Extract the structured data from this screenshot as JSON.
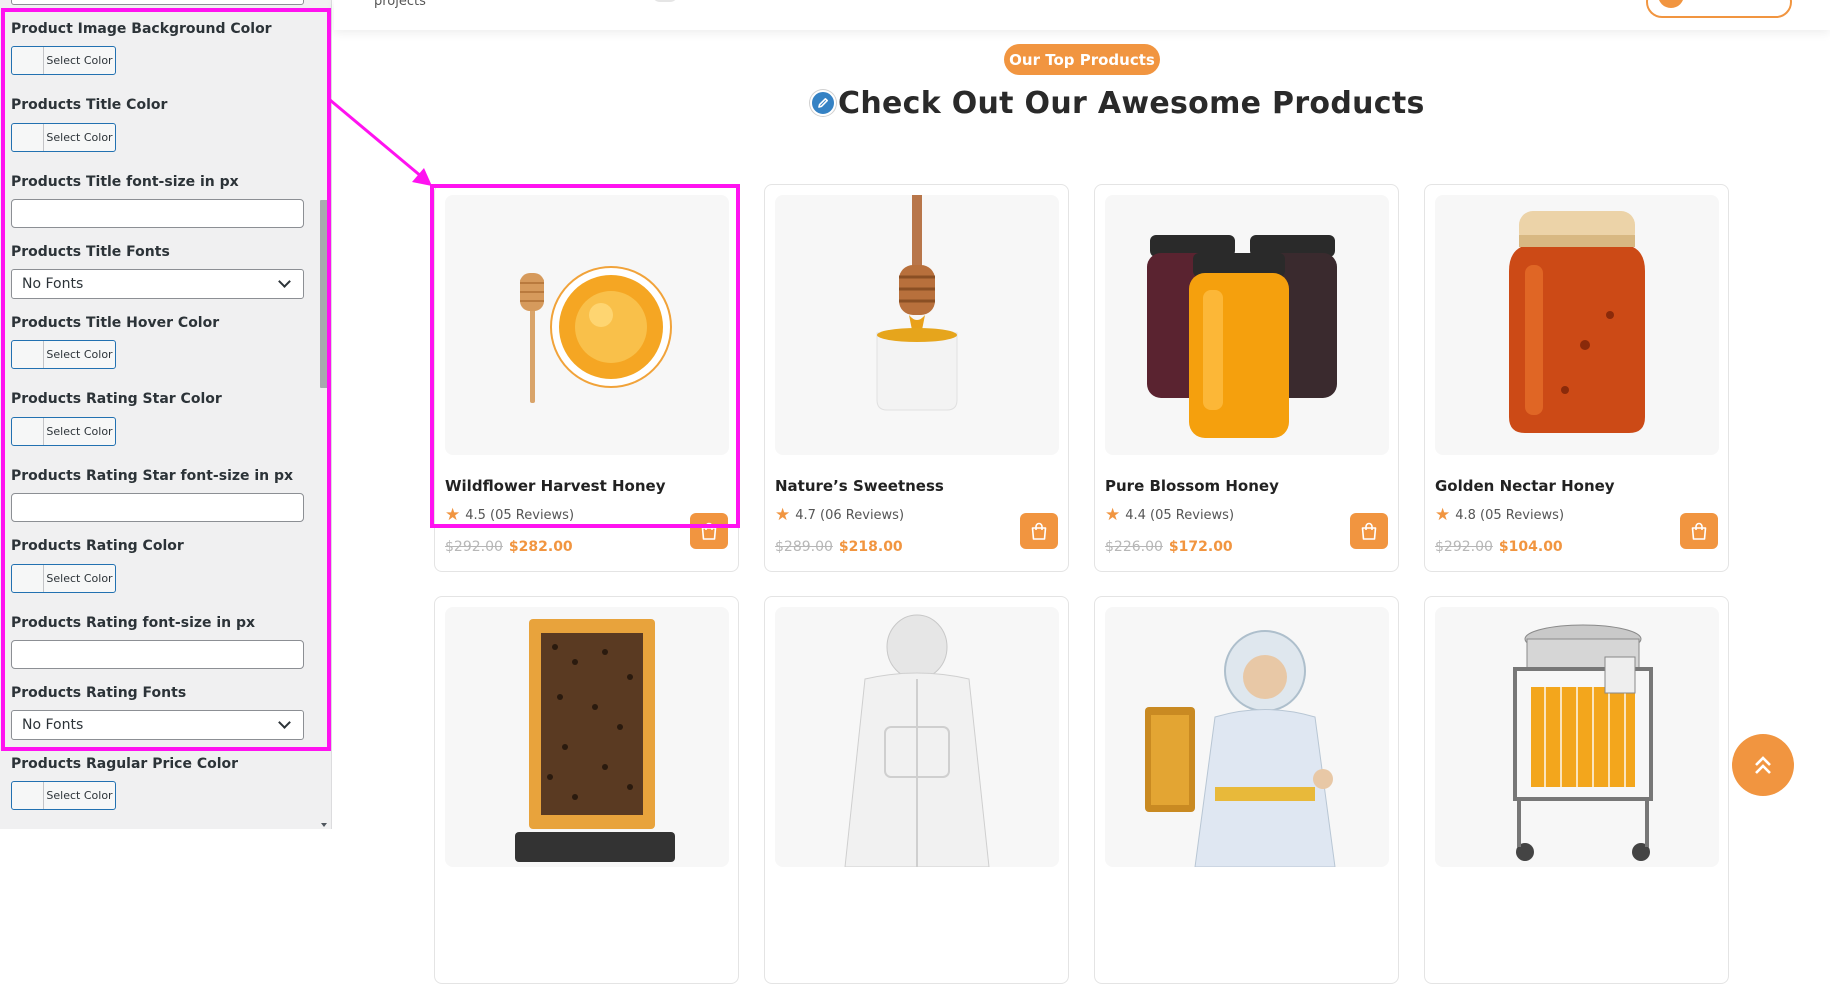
{
  "customizer": {
    "fields": [
      {
        "label": "Product Image Background Color",
        "type": "color",
        "button": "Select Color"
      },
      {
        "label": "Products Title Color",
        "type": "color",
        "button": "Select Color"
      },
      {
        "label": "Products Title font-size in px",
        "type": "text",
        "value": ""
      },
      {
        "label": "Products Title Fonts",
        "type": "select",
        "value": "No Fonts"
      },
      {
        "label": "Products Title Hover Color",
        "type": "color",
        "button": "Select Color"
      },
      {
        "label": "Products Rating Star Color",
        "type": "color",
        "button": "Select Color"
      },
      {
        "label": "Products Rating Star font-size in px",
        "type": "text",
        "value": ""
      },
      {
        "label": "Products Rating Color",
        "type": "color",
        "button": "Select Color"
      },
      {
        "label": "Products Rating font-size in px",
        "type": "text",
        "value": ""
      },
      {
        "label": "Products Rating Fonts",
        "type": "select",
        "value": "No Fonts"
      },
      {
        "label": "Products Ragular Price Color",
        "type": "color",
        "button": "Select Color"
      }
    ]
  },
  "header": {
    "projects_text": "projects"
  },
  "section": {
    "badge": "Our Top Products",
    "title": "Check Out Our Awesome Products"
  },
  "products": [
    {
      "title": "Wildflower Harvest Honey",
      "rating": "4.5 (05 Reviews)",
      "old_price": "$292.00",
      "price": "$282.00",
      "image": "honey-dipper-bowl"
    },
    {
      "title": "Nature’s Sweetness",
      "rating": "4.7 (06 Reviews)",
      "old_price": "$289.00",
      "price": "$218.00",
      "image": "honey-dipper-cup"
    },
    {
      "title": "Pure Blossom Honey",
      "rating": "4.4 (05 Reviews)",
      "old_price": "$226.00",
      "price": "$172.00",
      "image": "three-jars"
    },
    {
      "title": "Golden Nectar Honey",
      "rating": "4.8 (05 Reviews)",
      "old_price": "$292.00",
      "price": "$104.00",
      "image": "single-jar"
    },
    {
      "image": "honeycomb-frame-bees"
    },
    {
      "image": "beekeeper-suit"
    },
    {
      "image": "beekeeper-holding-frame"
    },
    {
      "image": "honey-extractor-machine"
    }
  ],
  "colors": {
    "accent": "#f19540",
    "highlight": "#ff12f0",
    "wp_blue": "#2271b1"
  }
}
